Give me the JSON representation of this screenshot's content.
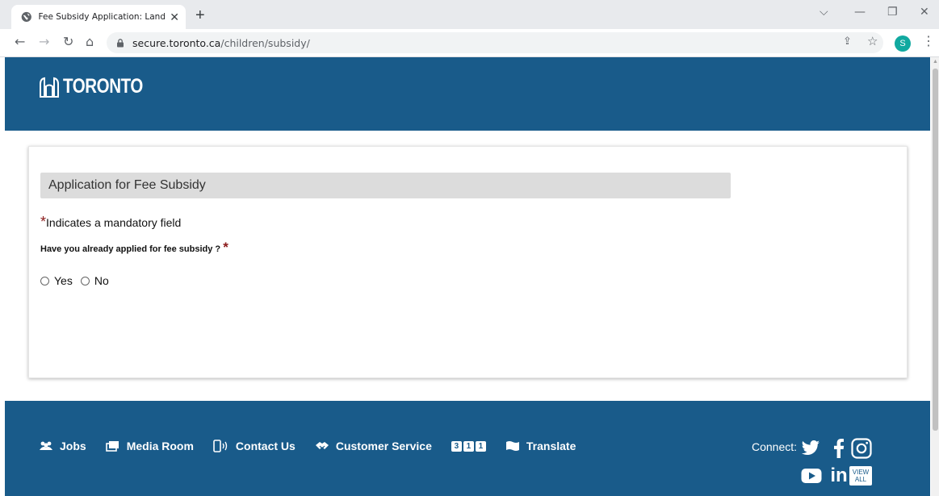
{
  "browser": {
    "tab_title": "Fee Subsidy Application: Landing",
    "url_host": "secure.toronto.ca",
    "url_path": "/children/subsidy/",
    "profile_initial": "S"
  },
  "header": {
    "logo_text": "TORONTO"
  },
  "form": {
    "heading": "Application for Fee Subsidy",
    "mandatory_star": "*",
    "mandatory_note": "Indicates a mandatory field",
    "question": "Have you already applied for fee subsidy ?",
    "question_star": "*",
    "options": [
      {
        "label": "Yes",
        "selected": false
      },
      {
        "label": "No",
        "selected": false
      }
    ]
  },
  "footer": {
    "links": [
      {
        "label": "Jobs",
        "icon": "people-icon"
      },
      {
        "label": "Media Room",
        "icon": "media-icon"
      },
      {
        "label": "Contact Us",
        "icon": "phone-icon"
      },
      {
        "label": "Customer Service",
        "icon": "handshake-icon"
      },
      {
        "label": "Translate",
        "icon": "flag-icon"
      }
    ],
    "badge_311": "311",
    "connect_label": "Connect:",
    "view_all": "VIEW ALL",
    "view_all_top": "VIEW",
    "view_all_bottom": "ALL"
  },
  "colors": {
    "brand_blue": "#195b8a",
    "required_star": "#8b1a1a",
    "heading_bar": "#dcdcdc"
  }
}
